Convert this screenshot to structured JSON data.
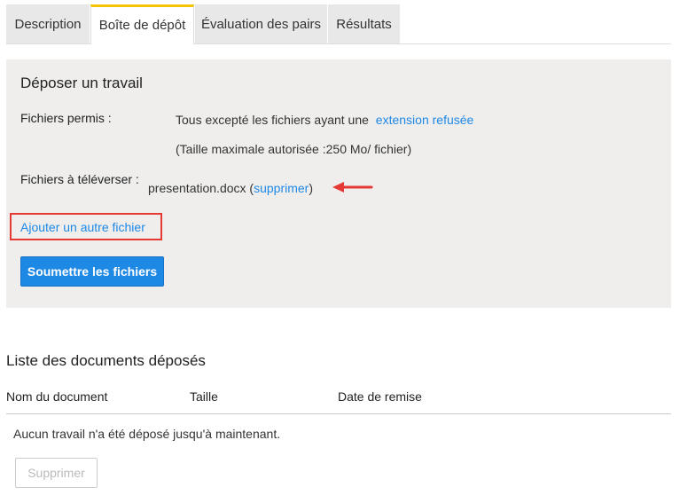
{
  "tabs": [
    {
      "label": "Description"
    },
    {
      "label": "Boîte de dépôt"
    },
    {
      "label": "Évaluation des pairs"
    },
    {
      "label": "Résultats"
    }
  ],
  "active_tab_index": 1,
  "colors": {
    "accent_link": "#1e88e5",
    "active_tab_indicator": "#f2c500",
    "highlight_box": "#e53935",
    "annotation_arrow": "#e53935",
    "panel_background": "#efeeed"
  },
  "upload": {
    "title": "Déposer un travail",
    "allowed_label": "Fichiers permis :",
    "allowed_text": "Tous excepté les fichiers ayant une",
    "allowed_link": "extension refusée",
    "max_size_text": "(Taille maximale autorisée :250 Mo/ fichier)",
    "files_label": "Fichiers à téléverser :",
    "file_name": "presentation.docx",
    "open_paren": "(",
    "remove_link": "supprimer",
    "close_paren": ")",
    "add_another_link": "Ajouter un autre fichier",
    "submit_button": "Soumettre les fichiers",
    "annotation_arrow_icon": "left-arrow-icon"
  },
  "documents": {
    "title": "Liste des documents déposés",
    "columns": [
      "Nom du document",
      "Taille",
      "Date de remise"
    ],
    "empty_message": "Aucun travail n'a été déposé jusqu'à maintenant.",
    "delete_button": "Supprimer",
    "delete_button_enabled": false
  }
}
